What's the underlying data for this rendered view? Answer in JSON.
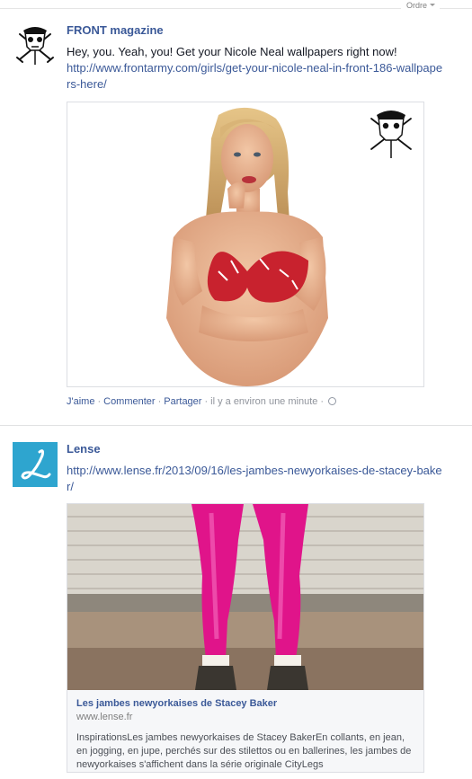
{
  "header": {
    "sort_label": "Ordre"
  },
  "posts": [
    {
      "author": "FRONT magazine",
      "message": "Hey, you. Yeah, you! Get your Nicole Neal wallpapers right now!",
      "link": "http://www.frontarmy.com/girls/get-your-nicole-neal-in-front-186-wallpapers-here/",
      "actions": {
        "like": "J'aime",
        "comment": "Commenter",
        "share": "Partager",
        "time": "il y a environ une minute"
      }
    },
    {
      "author": "Lense",
      "link": "http://www.lense.fr/2013/09/16/les-jambes-newyorkaises-de-stacey-baker/",
      "share": {
        "title": "Les jambes newyorkaises de Stacey Baker",
        "domain": "www.lense.fr",
        "description": "InspirationsLes jambes newyorkaises de Stacey BakerEn collants, en jean, en jogging, en jupe, perchés sur des stilettos ou en ballerines, les jambes de newyorkaises s'affichent dans la série originale CityLegs"
      }
    }
  ],
  "colors": {
    "link": "#3b5998",
    "lense_brand": "#2ea5cf",
    "leggings": "#e0148a"
  }
}
